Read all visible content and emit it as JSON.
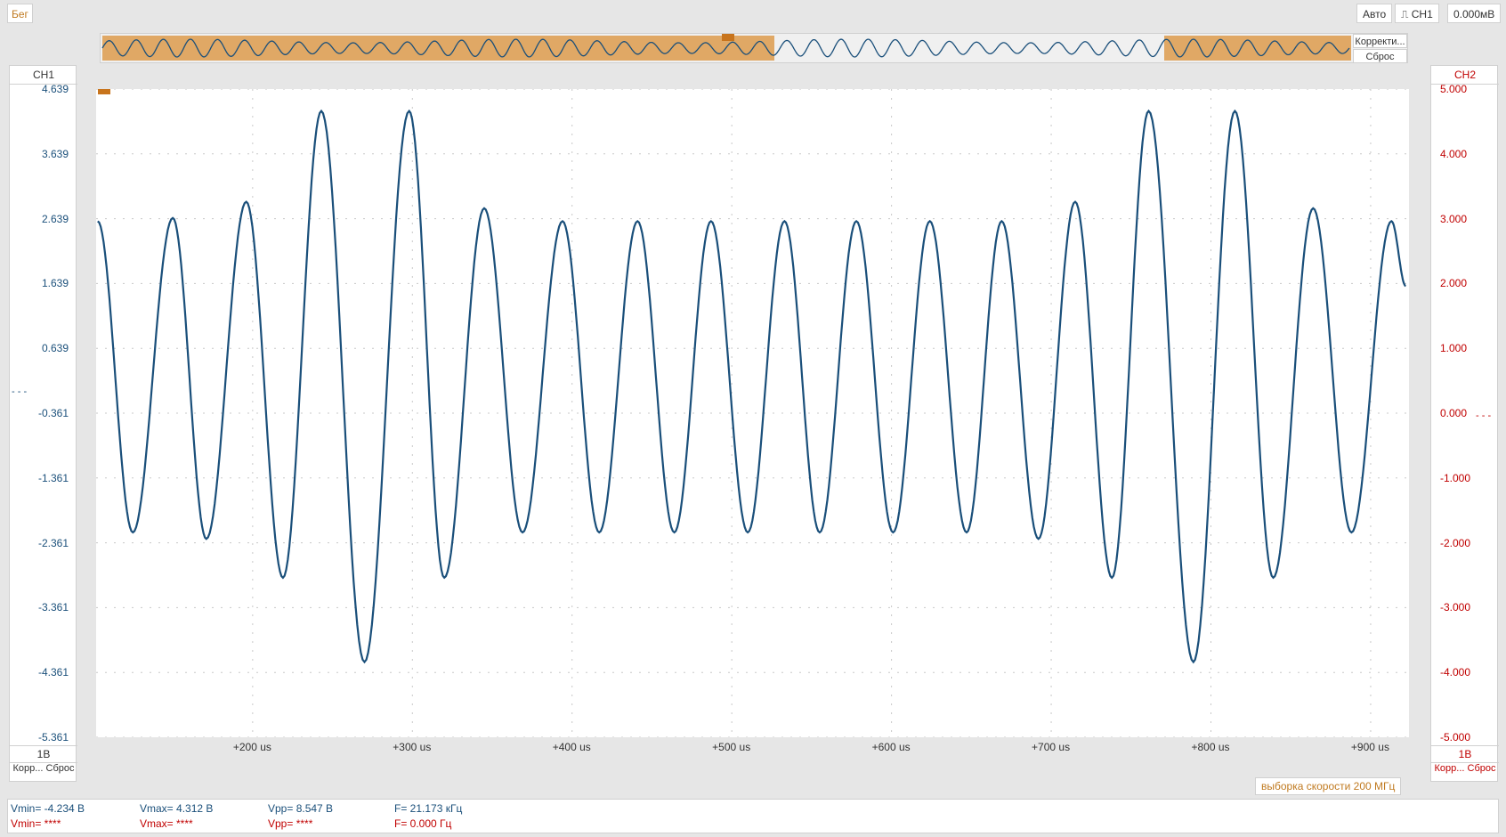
{
  "toolbar": {
    "status": "Бег",
    "mode": "Авто",
    "trigger_channel": "CH1",
    "trigger_level": "0.000мВ",
    "overview_btn1": "Корректи...",
    "overview_btn2": "Сброс"
  },
  "ch1": {
    "name": "CH1",
    "scale": "1В",
    "coupling": "Корр... Сброс",
    "color": "#1a4f7a"
  },
  "ch2": {
    "name": "CH2",
    "scale": "1В",
    "coupling": "Корр... Сброс",
    "color": "#c00000"
  },
  "sample_rate": "выборка скорости 200 МГц",
  "measurements": {
    "ch1": {
      "vmin": "Vmin= -4.234 В",
      "vmax": "Vmax= 4.312 В",
      "vpp": "Vpp= 8.547 В",
      "freq": "F= 21.173 кГц"
    },
    "ch2": {
      "vmin": "Vmin= ****",
      "vmax": "Vmax= ****",
      "vpp": "Vpp= ****",
      "freq": "F= 0.000 Гц"
    }
  },
  "chart_data": {
    "type": "line",
    "x_ticks": [
      "+200 us",
      "+300 us",
      "+400 us",
      "+500 us",
      "+600 us",
      "+700 us",
      "+800 us",
      "+900 us"
    ],
    "x_tick_values": [
      200,
      300,
      400,
      500,
      600,
      700,
      800,
      900
    ],
    "y_ticks_ch1": [
      "4.639",
      "3.639",
      "2.639",
      "1.639",
      "0.639",
      "-0.361",
      "-1.361",
      "-2.361",
      "-3.361",
      "-4.361",
      "-5.361"
    ],
    "y_ticks_ch2": [
      "5.000",
      "4.000",
      "3.000",
      "2.000",
      "1.000",
      "0.000",
      "-1.000",
      "-2.000",
      "-3.000",
      "-4.000",
      "-5.000"
    ],
    "ylim_ch1": [
      -5.361,
      4.639
    ],
    "xlim": [
      102,
      924
    ],
    "series": [
      {
        "name": "CH1",
        "color": "#1a4f7a",
        "extrema": [
          [
            103,
            2.6
          ],
          [
            125,
            -2.2
          ],
          [
            150,
            2.65
          ],
          [
            171,
            -2.3
          ],
          [
            196,
            2.9
          ],
          [
            219,
            -2.9
          ],
          [
            243,
            4.3
          ],
          [
            270,
            -4.2
          ],
          [
            298,
            4.3
          ],
          [
            320,
            -2.9
          ],
          [
            345,
            2.8
          ],
          [
            369,
            -2.2
          ],
          [
            394,
            2.6
          ],
          [
            417,
            -2.2
          ],
          [
            441,
            2.6
          ],
          [
            464,
            -2.2
          ],
          [
            487,
            2.6
          ],
          [
            510,
            -2.2
          ],
          [
            533,
            2.6
          ],
          [
            555,
            -2.2
          ],
          [
            578,
            2.6
          ],
          [
            601,
            -2.2
          ],
          [
            624,
            2.6
          ],
          [
            647,
            -2.2
          ],
          [
            669,
            2.6
          ],
          [
            692,
            -2.3
          ],
          [
            715,
            2.9
          ],
          [
            738,
            -2.9
          ],
          [
            761,
            4.3
          ],
          [
            789,
            -4.2
          ],
          [
            815,
            4.3
          ],
          [
            839,
            -2.9
          ],
          [
            864,
            2.8
          ],
          [
            888,
            -2.2
          ],
          [
            913,
            2.6
          ],
          [
            922,
            1.6
          ]
        ]
      }
    ]
  }
}
